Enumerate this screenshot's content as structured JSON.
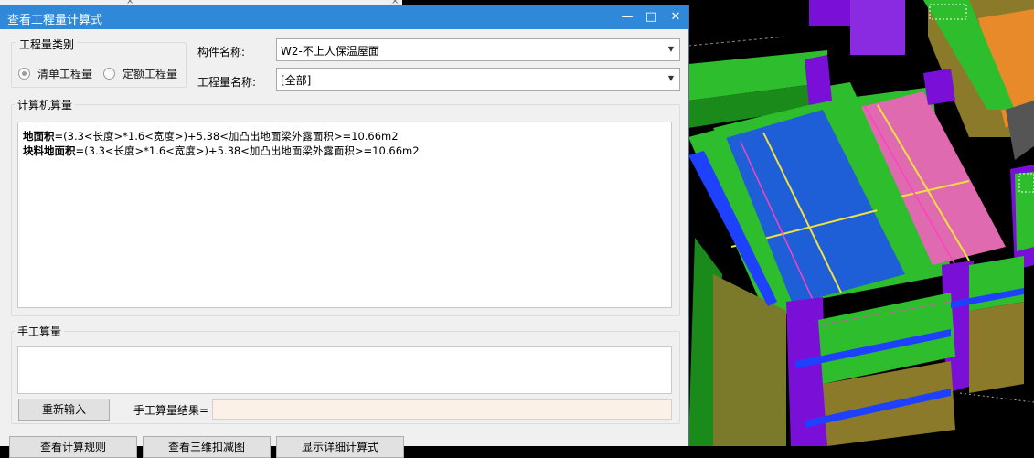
{
  "dialog": {
    "title": "查看工程量计算式",
    "controls": {
      "minimize": "—",
      "maximize": "□",
      "close": "✕"
    },
    "quantity_type": {
      "legend": "工程量类别",
      "options": [
        {
          "label": "清单工程量",
          "selected": true
        },
        {
          "label": "定额工程量",
          "selected": false
        }
      ]
    },
    "component_name": {
      "label": "构件名称:",
      "value": "W2-不上人保温屋面"
    },
    "quantity_name": {
      "label": "工程量名称:",
      "value": "[全部]"
    },
    "computed": {
      "legend": "计算机算量",
      "lines": [
        {
          "name": "地面积",
          "expr": "=(3.3<长度>*1.6<宽度>)+5.38<加凸出地面梁外露面积>=10.66m2"
        },
        {
          "name": "块料地面积",
          "expr": "=(3.3<长度>*1.6<宽度>)+5.38<加凸出地面梁外露面积>=10.66m2"
        }
      ]
    },
    "manual": {
      "legend": "手工算量",
      "reinput_button": "重新输入",
      "result_label": "手工算量结果=",
      "result_value": ""
    },
    "bottom_buttons": [
      "查看计算规则",
      "查看三维扣减图",
      "显示详细计算式"
    ]
  },
  "background": {
    "close_glyphs": [
      "×",
      "×"
    ]
  },
  "colors": {
    "titlebar": "#2f88d8",
    "result_bg": "#fbf1e6",
    "dialog_bg": "#f0f0f0"
  }
}
